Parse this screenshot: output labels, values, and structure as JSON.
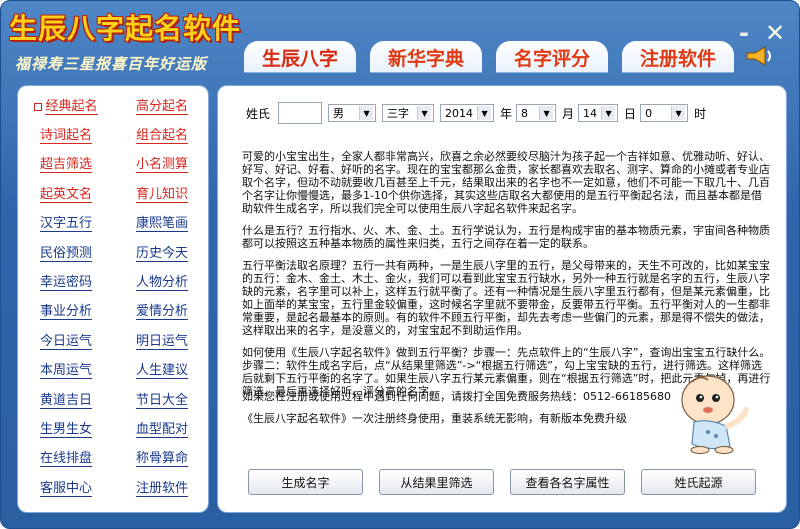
{
  "app": {
    "title": "生辰八字起名软件",
    "subtitle": "福禄寿三星报喜百年好运版"
  },
  "window_controls": {
    "minimize": "-",
    "close": "✕"
  },
  "tabs": [
    "生辰八字",
    "新华字典",
    "名字评分",
    "注册软件"
  ],
  "sidebar": {
    "items": [
      {
        "label": "经典起名",
        "color": "red"
      },
      {
        "label": "高分起名",
        "color": "red"
      },
      {
        "label": "诗词起名",
        "color": "red"
      },
      {
        "label": "组合起名",
        "color": "red"
      },
      {
        "label": "超吉筛选",
        "color": "red"
      },
      {
        "label": "小名测算",
        "color": "red"
      },
      {
        "label": "起英文名",
        "color": "red"
      },
      {
        "label": "育儿知识",
        "color": "red"
      },
      {
        "label": "汉字五行",
        "color": "blue"
      },
      {
        "label": "康熙笔画",
        "color": "blue"
      },
      {
        "label": "民俗预测",
        "color": "blue"
      },
      {
        "label": "历史今天",
        "color": "blue"
      },
      {
        "label": "幸运密码",
        "color": "blue"
      },
      {
        "label": "人物分析",
        "color": "blue"
      },
      {
        "label": "事业分析",
        "color": "blue"
      },
      {
        "label": "爱情分析",
        "color": "blue"
      },
      {
        "label": "今日运气",
        "color": "blue"
      },
      {
        "label": "明日运气",
        "color": "blue"
      },
      {
        "label": "本周运气",
        "color": "blue"
      },
      {
        "label": "人生建议",
        "color": "blue"
      },
      {
        "label": "黄道吉日",
        "color": "blue"
      },
      {
        "label": "节日大全",
        "color": "blue"
      },
      {
        "label": "生男生女",
        "color": "blue"
      },
      {
        "label": "血型配对",
        "color": "blue"
      },
      {
        "label": "在线排盘",
        "color": "blue"
      },
      {
        "label": "称骨算命",
        "color": "blue"
      },
      {
        "label": "客服中心",
        "color": "blue"
      },
      {
        "label": "注册软件",
        "color": "blue"
      }
    ]
  },
  "form": {
    "surname_label": "姓氏",
    "surname_value": "",
    "gender": "男",
    "name_length": "三字",
    "year": "2014",
    "year_unit": "年",
    "month": "8",
    "month_unit": "月",
    "day": "14",
    "day_unit": "日",
    "hour": "0",
    "hour_unit": "时"
  },
  "article": {
    "p1": "可爱的小宝宝出生，全家人都非常高兴，欣喜之余必然要绞尽脑汁为孩子起一个吉祥如意、优雅动听、好认、好写、好记、好看、好听的名字。现在的宝宝都那么金贵，家长都喜欢去取名、测字、算命的小摊或者专业店取个名字，但动不动就要收几百甚至上千元，结果取出来的名字也不一定如意，他们不可能一下取几十、几百个名字让你慢慢选，最多1-10个供你选择，其实这些店取名大都使用的是五行平衡起名法，而且基本都是借助软件生成名字，所以我们完全可以使用生辰八字起名软件来起名字。",
    "p2": "什么是五行？五行指水、火、木、金、土。五行学说认为，五行是构成宇宙的基本物质元素，宇宙间各种物质都可以按照这五种基本物质的属性来归类，五行之间存在着一定的联系。",
    "p3": "五行平衡法取名原理？五行一共有两种，一是生辰八字里的五行，是父母带来的，天生不可改的，比如某宝宝的五行：金木、金土、木土、金火，我们可以看到此宝宝五行缺水，另外一种五行就是名字的五行，生辰八字缺的元素，名字里可以补上，这样五行就平衡了。还有一种情况是生辰八字里五行都有，但是某元素偏重，比如上面举的某宝宝，五行里金较偏重，这时候名字里就不要带金，反要带五行平衡。五行平衡对人的一生都非常重要，是起名最基本的原则。有的软件不顾五行平衡，却先去考虑一些偏门的元素，那是得不偿失的做法，这样取出来的名字，是没意义的，对宝宝起不到助运作用。",
    "p4": "如何使用《生辰八字起名软件》做到五行平衡？步骤一：先点软件上的“生辰八字”，查询出宝宝五行缺什么。步骤二：软件生成名字后，点“从结果里筛选”->“根据五行筛选”，勾上宝宝缺的五行，进行筛选。这样筛选后就剩下五行平衡的名字了。如果生辰八字五行某元素偏重，则在“根据五行筛选”时，把此元素勾掉，再进行筛选。最后再选择好听、评分高的名字。"
  },
  "hotline": "如果您在注册或使用过程中遇到任何问题，请拨打全国免费服务热线：0512-66185680",
  "notice": "《生辰八字起名软件》一次注册终身使用，重装系统无影响，有新版本免费升级",
  "buttons": [
    "生成名字",
    "从结果里筛选",
    "查看各名字属性",
    "姓氏起源"
  ],
  "colors": {
    "accent_red": "#d6261d",
    "link_blue": "#1a3a8c",
    "window_blue": "#2f66ab",
    "title_yellow": "#ffd21a"
  }
}
